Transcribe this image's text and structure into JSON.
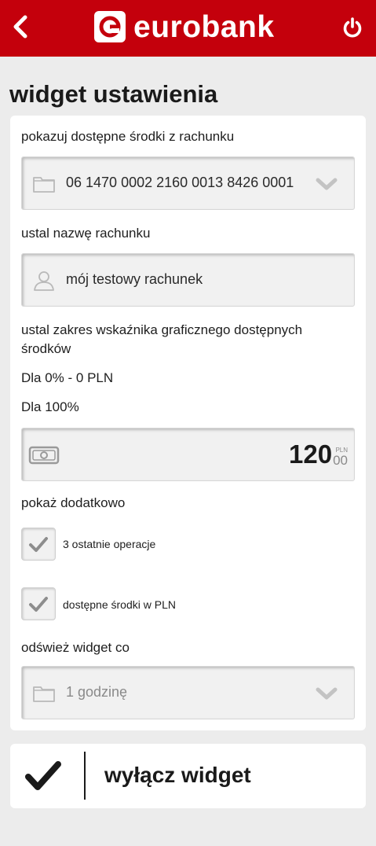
{
  "header": {
    "brand": "eurobank",
    "back_icon": "chevron-left-icon",
    "power_icon": "power-icon",
    "color": "#c4000c"
  },
  "page": {
    "title": "widget ustawienia"
  },
  "account_section": {
    "label": "pokazuj dostępne środki z rachunku",
    "selected_account": "06 1470 0002 2160 0013 8426 0001"
  },
  "name_section": {
    "label": "ustal nazwę rachunku",
    "value": "mój testowy rachunek"
  },
  "range_section": {
    "label": "ustal zakres wskaźnika graficznego dostępnych środków",
    "min_text": "Dla 0% - 0 PLN",
    "max_text": "Dla 100%",
    "amount_int": "120",
    "amount_dec": "00",
    "amount_currency": "PLN"
  },
  "extra_section": {
    "label": "pokaż dodatkowo",
    "options": [
      {
        "label": "3 ostatnie operacje",
        "checked": true
      },
      {
        "label": "dostępne środki w PLN",
        "checked": true
      }
    ]
  },
  "refresh_section": {
    "label": "odśwież widget co",
    "selected": "1 godzinę"
  },
  "action": {
    "label": "wyłącz widget"
  }
}
